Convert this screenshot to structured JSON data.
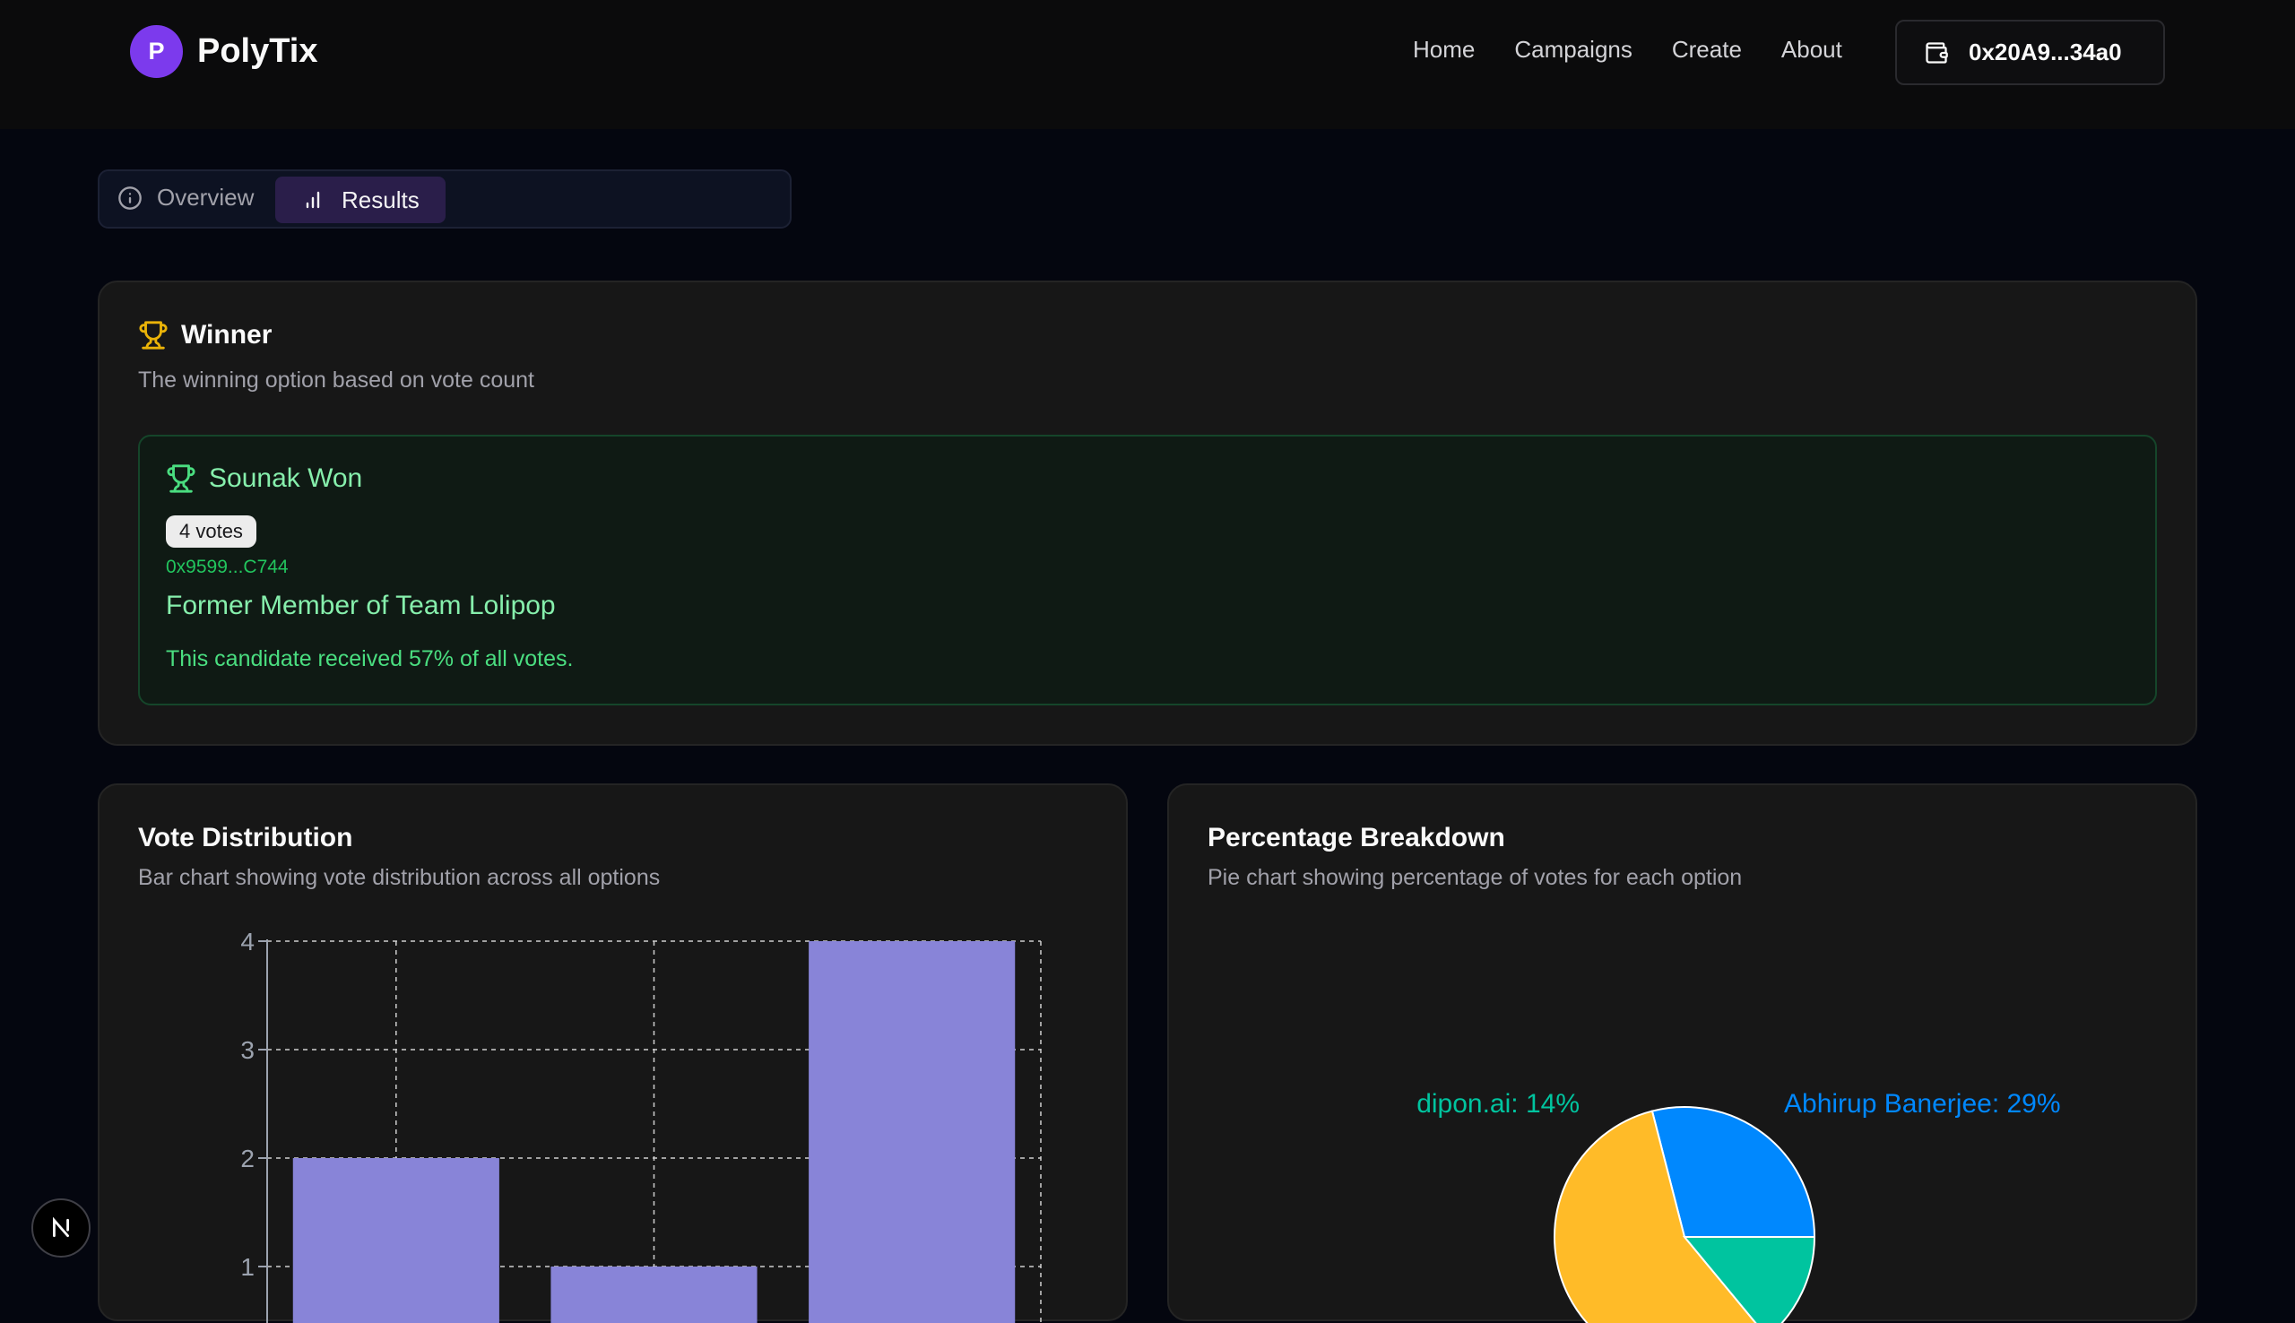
{
  "brand": {
    "logo_letter": "P",
    "name": "PolyTix"
  },
  "nav": {
    "items": [
      "Home",
      "Campaigns",
      "Create",
      "About"
    ]
  },
  "wallet": {
    "icon": "wallet-icon",
    "address": "0x20A9...34a0"
  },
  "tabs": [
    {
      "label": "Overview",
      "icon": "info-icon",
      "active": false
    },
    {
      "label": "Results",
      "icon": "bar-chart-icon",
      "active": true
    }
  ],
  "winner_card": {
    "title": "Winner",
    "subtitle": "The winning option based on vote count",
    "icon": "trophy-icon",
    "winner": {
      "title": "Sounak Won",
      "votes": "4 votes",
      "address": "0x9599...C744",
      "description": "Former Member of Team Lolipop",
      "percentage_text": "This candidate received 57% of all votes."
    }
  },
  "vote_distribution": {
    "title": "Vote Distribution",
    "subtitle": "Bar chart showing vote distribution across all options"
  },
  "percentage_breakdown": {
    "title": "Percentage Breakdown",
    "subtitle": "Pie chart showing percentage of votes for each option"
  },
  "colors": {
    "bar": "#8884d8",
    "pie_blue": "#0088fe",
    "pie_teal": "#00c49f",
    "pie_yellow": "#ffbb28",
    "winner_green": "#86efac",
    "accent_purple": "#7c3aed"
  },
  "chart_data": [
    {
      "type": "bar",
      "categories": [
        "",
        "",
        ""
      ],
      "values": [
        2,
        1,
        4
      ],
      "yticks": [
        1,
        2,
        3,
        4
      ],
      "ylim": [
        0,
        4
      ],
      "grid": true,
      "note": ""
    },
    {
      "type": "pie",
      "labels": [
        "Abhirup Banerjee",
        "Sounak",
        "dipon.ai"
      ],
      "values": [
        29,
        57,
        14
      ],
      "slice_labels": [
        "Abhirup Banerjee: 29%",
        "dipon.ai: 14%"
      ],
      "colors": [
        "#0088fe",
        "#ffbb28",
        "#00c49f"
      ]
    }
  ],
  "dev_badge": {
    "letter": "N"
  }
}
